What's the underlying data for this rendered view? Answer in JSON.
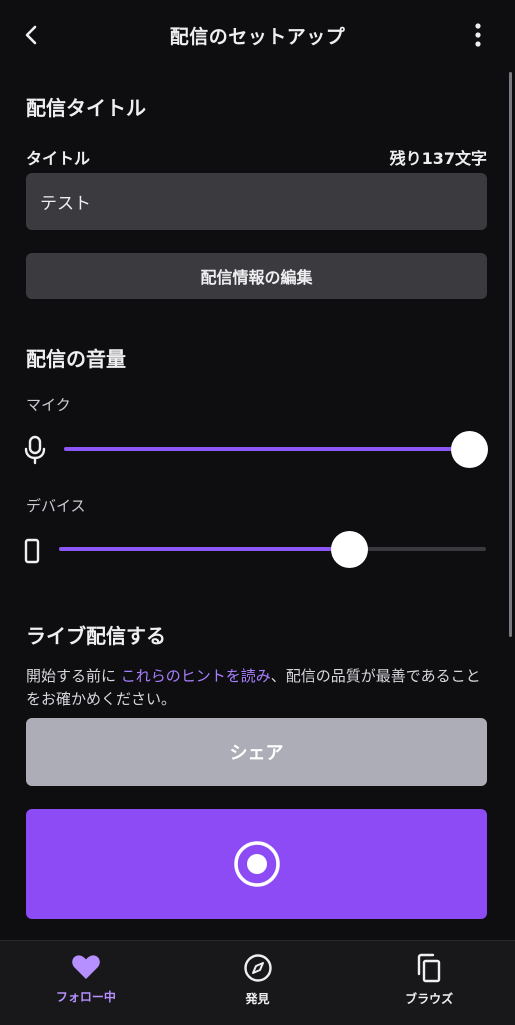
{
  "header": {
    "title": "配信のセットアップ",
    "back_icon": "chevron-left-icon",
    "more_icon": "more-vertical-icon"
  },
  "stream_title_section": {
    "heading": "配信タイトル",
    "title_label": "タイトル",
    "chars_remaining": "残り137文字",
    "title_value": "テスト",
    "edit_button": "配信情報の編集"
  },
  "volume_section": {
    "heading": "配信の音量",
    "mic_label": "マイク",
    "mic_level": 1.0,
    "device_label": "デバイス",
    "device_level": 0.68
  },
  "live_section": {
    "heading": "ライブ配信する",
    "hint_before": "開始する前に ",
    "hint_link": "これらのヒントを読み",
    "hint_after": "、配信の品質が最善であることをお確かめください。",
    "share_button": "シェア",
    "go_live_icon": "record-icon"
  },
  "colors": {
    "accent": "#8c4bf5",
    "slider_fill": "#8c57f6",
    "link": "#a87fff",
    "background": "#0e0e10"
  },
  "bottom_nav": {
    "items": [
      {
        "label": "フォロー中",
        "icon": "heart-icon",
        "active": true
      },
      {
        "label": "発見",
        "icon": "compass-icon",
        "active": false
      },
      {
        "label": "ブラウズ",
        "icon": "copy-icon",
        "active": false
      }
    ]
  }
}
